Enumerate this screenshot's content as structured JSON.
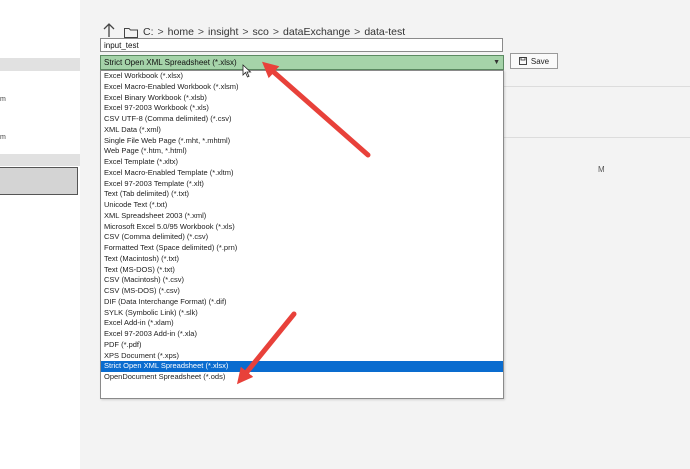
{
  "sidebar": {
    "fragments": [
      "m",
      "m"
    ]
  },
  "navigation": {
    "up_icon": "up-arrow-icon",
    "folder_icon": "folder-icon",
    "path": [
      "C:",
      "home",
      "insight",
      "sco",
      "dataExchange",
      "data-test"
    ],
    "separator": ">"
  },
  "filename": {
    "value": "input_test"
  },
  "filetype": {
    "selected": "Strict Open XML Spreadsheet (*.xlsx)",
    "options": [
      "Excel Workbook (*.xlsx)",
      "Excel Macro-Enabled Workbook (*.xlsm)",
      "Excel Binary Workbook (*.xlsb)",
      "Excel 97-2003 Workbook (*.xls)",
      "CSV UTF-8 (Comma delimited) (*.csv)",
      "XML Data (*.xml)",
      "Single File Web Page (*.mht, *.mhtml)",
      "Web Page (*.htm, *.html)",
      "Excel Template (*.xltx)",
      "Excel Macro-Enabled Template (*.xltm)",
      "Excel 97-2003 Template (*.xlt)",
      "Text (Tab delimited) (*.txt)",
      "Unicode Text (*.txt)",
      "XML Spreadsheet 2003 (*.xml)",
      "Microsoft Excel 5.0/95 Workbook (*.xls)",
      "CSV (Comma delimited) (*.csv)",
      "Formatted Text (Space delimited) (*.prn)",
      "Text (Macintosh) (*.txt)",
      "Text (MS-DOS) (*.txt)",
      "CSV (Macintosh) (*.csv)",
      "CSV (MS-DOS) (*.csv)",
      "DIF (Data Interchange Format) (*.dif)",
      "SYLK (Symbolic Link) (*.slk)",
      "Excel Add-in (*.xlam)",
      "Excel 97-2003 Add-in (*.xla)",
      "PDF (*.pdf)",
      "XPS Document (*.xps)",
      "Strict Open XML Spreadsheet (*.xlsx)",
      "OpenDocument Spreadsheet (*.ods)"
    ],
    "highlighted_index": 27
  },
  "toolbar": {
    "save_label": "Save",
    "save_icon": "save-disk-icon"
  },
  "right_fragment": "M",
  "colors": {
    "selected_highlight": "#0a6ccf",
    "select_fill": "#a5d3a9",
    "annotation_arrow": "#e8413a"
  }
}
